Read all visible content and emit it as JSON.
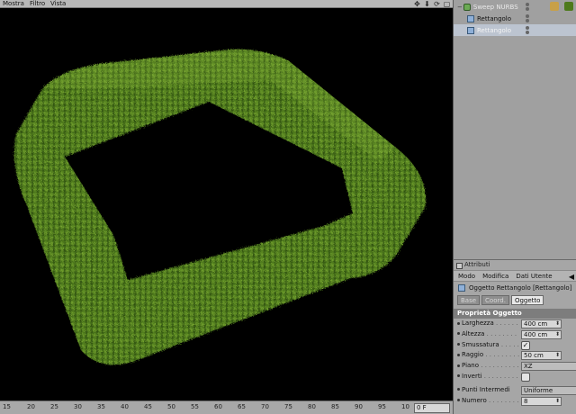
{
  "viewport": {
    "menu": [
      "Mostra",
      "Filtro",
      "Vista"
    ],
    "tools": [
      "move-icon",
      "arrow-down-icon",
      "rotate-icon",
      "maximize-icon"
    ]
  },
  "timeline": {
    "ticks": [
      "15",
      "20",
      "25",
      "30",
      "35",
      "40",
      "45",
      "50",
      "55",
      "60",
      "65",
      "70",
      "75",
      "80",
      "85",
      "90",
      "95",
      "10"
    ],
    "frame": "0 F"
  },
  "object_manager": {
    "parent": "Sweep NURBS",
    "children": [
      "Rettangolo",
      "Rettangolo"
    ]
  },
  "attributes": {
    "title": "Attributi",
    "menu": [
      "Modo",
      "Modifica",
      "Dati Utente"
    ],
    "object_name": "Oggetto Rettangolo [Rettangolo]",
    "tabs": [
      "Base",
      "Coord.",
      "Oggetto"
    ],
    "active_tab": "Oggetto",
    "section": "Proprietà Oggetto",
    "params": {
      "larghezza_label": "Larghezza",
      "larghezza_value": "400 cm",
      "altezza_label": "Altezza",
      "altezza_value": "400 cm",
      "smussatura_label": "Smussatura",
      "raggio_label": "Raggio",
      "raggio_value": "50 cm",
      "piano_label": "Piano",
      "piano_value": "XZ",
      "inverti_label": "Inverti",
      "punti_label": "Punti Intermedi",
      "punti_value": "Uniforme",
      "numero_label": "Numero",
      "numero_value": "8"
    }
  }
}
